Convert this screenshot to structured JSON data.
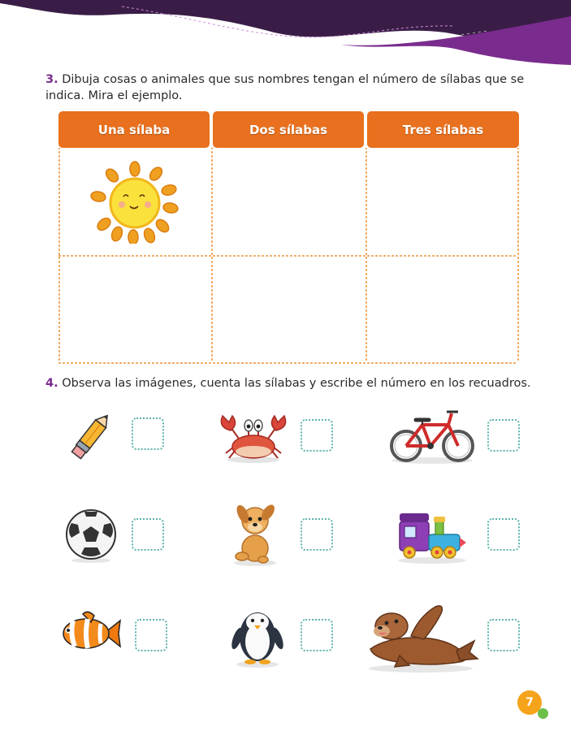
{
  "q3": {
    "number": "3.",
    "text": "Dibuja cosas o animales que sus nombres tengan el número de sílabas que se indica. Mira el ejemplo."
  },
  "table": {
    "headers": [
      "Una sílaba",
      "Dos sílabas",
      "Tres sílabas"
    ],
    "example_icon": "sun-icon"
  },
  "q4": {
    "number": "4.",
    "text": "Observa las imágenes, cuenta las sílabas y escribe el número en los recuadros."
  },
  "pictures": [
    {
      "icon": "pencil-icon"
    },
    {
      "icon": "crab-icon"
    },
    {
      "icon": "bicycle-icon"
    },
    {
      "icon": "soccer-ball-icon"
    },
    {
      "icon": "dog-icon"
    },
    {
      "icon": "toy-train-icon"
    },
    {
      "icon": "clownfish-icon"
    },
    {
      "icon": "penguin-icon"
    },
    {
      "icon": "sea-lion-icon"
    }
  ],
  "page_number": "7",
  "colors": {
    "accent": "#e8701e",
    "purple": "#7a2c8e",
    "banner": "#3a1d46",
    "box_dots": "#5fb3ad",
    "badge": "#f5a31a"
  }
}
